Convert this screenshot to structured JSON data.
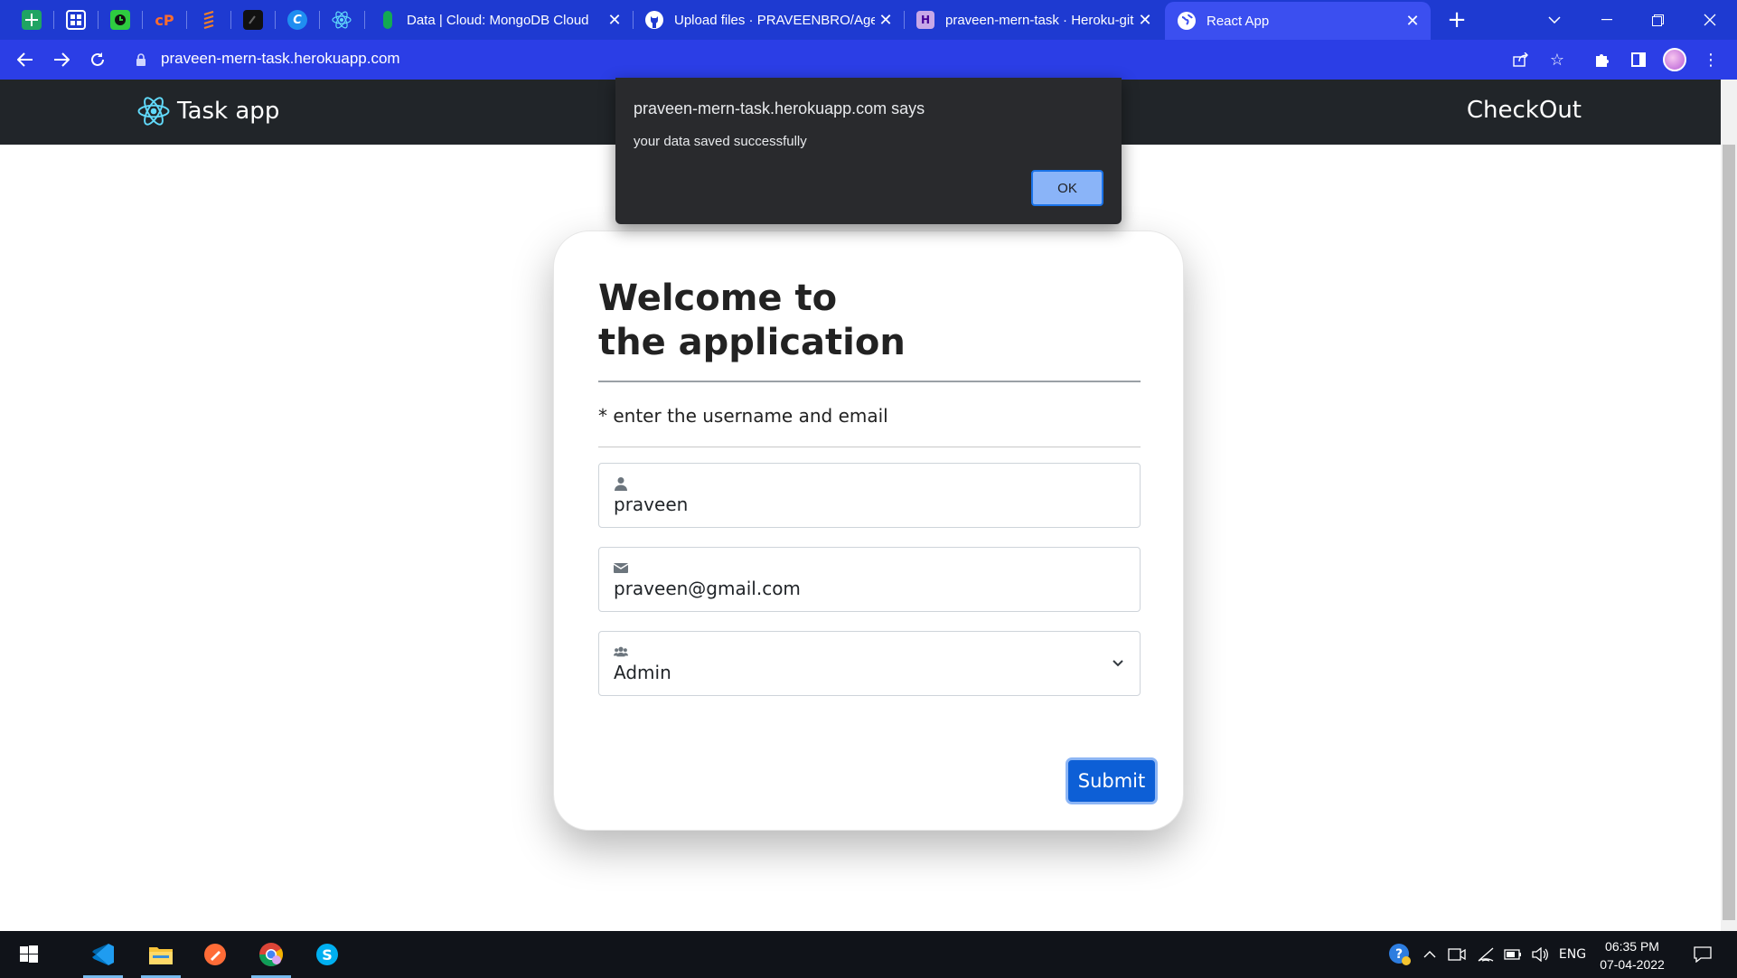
{
  "browser": {
    "pinned_tabs": [
      {
        "icon": "sheets-icon"
      },
      {
        "icon": "apps-grid-icon"
      },
      {
        "icon": "timer-icon"
      },
      {
        "icon": "cpanel-icon",
        "label": "cP"
      },
      {
        "icon": "stack-icon"
      },
      {
        "icon": "terminal-icon"
      },
      {
        "icon": "c-logo-icon",
        "label": "C"
      },
      {
        "icon": "react-icon"
      }
    ],
    "tabs": [
      {
        "title": "Data | Cloud: MongoDB Cloud",
        "icon": "mongodb-leaf-icon",
        "active": false
      },
      {
        "title": "Upload files · PRAVEENBRO/Age",
        "icon": "github-icon",
        "active": false
      },
      {
        "title": "praveen-mern-task · Heroku-git",
        "icon": "heroku-icon",
        "active": false
      },
      {
        "title": "React App",
        "icon": "globe-icon",
        "active": true
      }
    ],
    "url": "praveen-mern-task.herokuapp.com",
    "colors": {
      "frame": "#1e3ad1",
      "toolbar": "#2b3ee6"
    }
  },
  "app": {
    "brand": "Task app",
    "nav_link": "CheckOut",
    "card": {
      "title_line1": "Welcome to",
      "title_line2": "the application",
      "hint": "* enter the username and email",
      "username": "praveen",
      "email": "praveen@gmail.com",
      "role": "Admin",
      "submit_label": "Submit"
    },
    "colors": {
      "navbar": "#212529",
      "submit": "#0d5fd6"
    }
  },
  "dialog": {
    "title": "praveen-mern-task.herokuapp.com says",
    "message": "your data saved successfully",
    "ok_label": "OK"
  },
  "taskbar": {
    "apps": [
      "windows-start-icon",
      "vscode-icon",
      "file-explorer-icon",
      "postman-icon",
      "chrome-icon",
      "skype-icon"
    ],
    "language": "ENG",
    "time": "06:35 PM",
    "date": "07-04-2022"
  }
}
